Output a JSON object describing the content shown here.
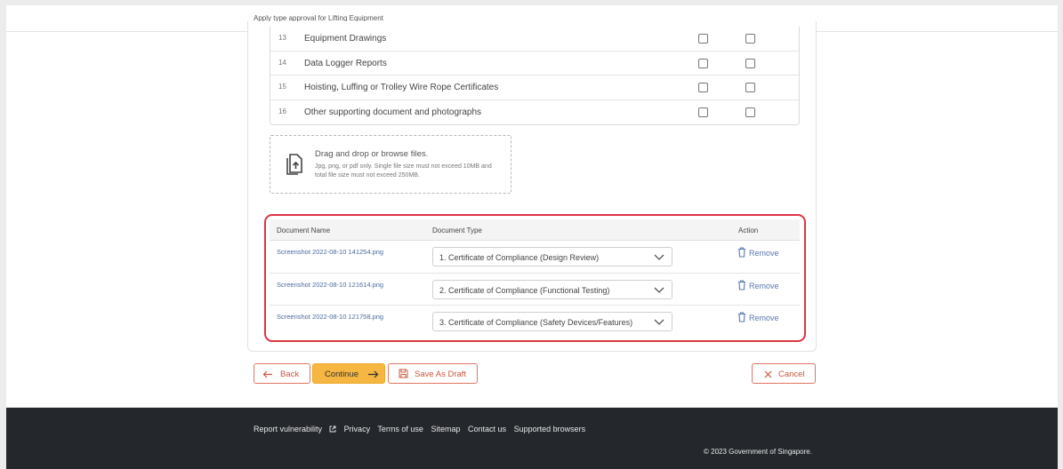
{
  "header": {
    "title": "Apply type approval for Lifting Equipment"
  },
  "requirements": [
    {
      "num": "13",
      "label": "Equipment Drawings"
    },
    {
      "num": "14",
      "label": "Data Logger Reports"
    },
    {
      "num": "15",
      "label": "Hoisting, Luffing or Trolley Wire Rope Certificates"
    },
    {
      "num": "16",
      "label": "Other supporting document and photographs"
    }
  ],
  "dropzone": {
    "icon": "file-upload-icon",
    "title": "Drag and drop or browse files.",
    "hint": "Jpg, png, or pdf only. Single file size must not exceed 10MB and total file size must not exceed 250MB."
  },
  "documents": {
    "headers": {
      "name": "Document Name",
      "type": "Document Type",
      "action": "Action"
    },
    "rows": [
      {
        "name": "Screenshot 2022-08-10 141254.png",
        "type": "1. Certificate of Compliance (Design Review)",
        "action": "Remove"
      },
      {
        "name": "Screenshot 2022-08-10 121614.png",
        "type": "2. Certificate of Compliance (Functional Testing)",
        "action": "Remove"
      },
      {
        "name": "Screenshot 2022-08-10 121758.png",
        "type": "3. Certificate of Compliance (Safety Devices/Features)",
        "action": "Remove"
      }
    ]
  },
  "actions": {
    "back": "Back",
    "continue": "Continue",
    "save_draft": "Save As Draft",
    "cancel": "Cancel"
  },
  "footer": {
    "links": [
      "Report vulnerability",
      "Privacy",
      "Terms of use",
      "Sitemap",
      "Contact us",
      "Supported browsers"
    ],
    "copyright": "© 2023 Government of Singapore."
  },
  "colors": {
    "highlight_border": "#dc3545",
    "primary_button": "#f5b642",
    "outline_button": "#e07563",
    "link": "#4a6a9e",
    "footer_bg": "#24272c"
  }
}
